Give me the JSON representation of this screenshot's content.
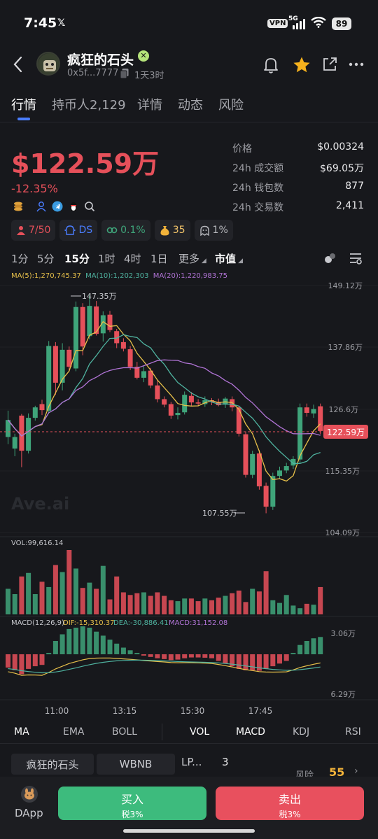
{
  "status_bar": {
    "time": "7:45",
    "x_label": "𝕏",
    "vpn": "VPN",
    "network": "5G",
    "battery": "89"
  },
  "token": {
    "name": "疯狂的石头",
    "address": "0x5f...7777",
    "age": "1天3时"
  },
  "tabs": [
    {
      "label": "行情",
      "active": true
    },
    {
      "label": "持币人2,129",
      "active": false
    },
    {
      "label": "详情",
      "active": false
    },
    {
      "label": "动态",
      "active": false
    },
    {
      "label": "风险",
      "active": false
    }
  ],
  "market": {
    "market_cap": "$122.59万",
    "change": "-12.35%"
  },
  "stats": [
    {
      "key": "价格",
      "value": "$0.00324"
    },
    {
      "key": "24h 成交额",
      "value": "$69.05万"
    },
    {
      "key": "24h 钱包数",
      "value": "877"
    },
    {
      "key": "24h 交易数",
      "value": "2,411"
    }
  ],
  "chips": [
    {
      "icon": "person-icon",
      "value": "7/50"
    },
    {
      "icon": "dev-icon",
      "value": "DS"
    },
    {
      "icon": "link-icon",
      "value": "0.1%"
    },
    {
      "icon": "money-bag-icon",
      "value": "35"
    },
    {
      "icon": "ghost-icon",
      "value": "1%"
    }
  ],
  "timeframes": [
    {
      "label": "1分",
      "active": false
    },
    {
      "label": "5分",
      "active": false
    },
    {
      "label": "15分",
      "active": true
    },
    {
      "label": "1时",
      "active": false
    },
    {
      "label": "4时",
      "active": false
    },
    {
      "label": "1日",
      "active": false
    },
    {
      "label": "更多",
      "active": false
    }
  ],
  "mode_select": "市值",
  "ma_legend": {
    "ma5": "MA(5):1,270,745.37",
    "ma10": "MA(10):1,202,303",
    "ma20": "MA(20):1,220,983.75"
  },
  "price_axis": [
    "149.12万",
    "137.86万",
    "126.6万",
    "115.35万",
    "104.09万"
  ],
  "current_tag": "122.59万",
  "high_label": "147.35万",
  "low_label": "107.55万",
  "watermark": "Ave.ai",
  "vol_label": "VOL:99,616.14",
  "macd_legend": {
    "title": "MACD(12,26,9)",
    "dif": "DIF:-15,310.37",
    "dea": "DEA:-30,886.41",
    "macd": "MACD:31,152.08"
  },
  "macd_axis": [
    "3.06万",
    "6.29万"
  ],
  "time_axis": [
    "11:00",
    "13:15",
    "15:30",
    "17:45"
  ],
  "indicators": [
    {
      "label": "MA",
      "active": true
    },
    {
      "label": "EMA",
      "active": false
    },
    {
      "label": "BOLL",
      "active": false
    },
    {
      "label": "VOL",
      "active": true
    },
    {
      "label": "MACD",
      "active": true
    },
    {
      "label": "KDJ",
      "active": false
    },
    {
      "label": "RSI",
      "active": false
    }
  ],
  "pair_tabs": [
    "疯狂的石头",
    "WBNB",
    "LP...",
    "3"
  ],
  "risk": {
    "label": "风险",
    "value": "55"
  },
  "bottom": {
    "dapp": "DApp",
    "buy": "买入",
    "buy_tax": "税3%",
    "sell": "卖出",
    "sell_tax": "税3%"
  },
  "colors": {
    "up": "#3fa47a",
    "down": "#e6505a",
    "accent": "#4a7dff",
    "ma5": "#e7c04a",
    "ma10": "#4fb3a0",
    "ma20": "#b174d6"
  },
  "candles": [
    [
      121.5,
      124.6,
      126.3,
      120.2
    ],
    [
      119.4,
      121.5,
      122.1,
      118.0
    ],
    [
      125.4,
      119.0,
      125.7,
      116.0
    ],
    [
      119.0,
      125.0,
      125.8,
      118.5
    ],
    [
      125.0,
      126.9,
      127.2,
      124.5
    ],
    [
      127.5,
      126.4,
      128.3,
      125.5
    ],
    [
      126.3,
      138.1,
      139.0,
      125.9
    ],
    [
      138.1,
      131.4,
      138.8,
      129.2
    ],
    [
      131.4,
      137.4,
      138.6,
      130.0
    ],
    [
      137.4,
      134.3,
      138.0,
      133.6
    ],
    [
      134.0,
      145.2,
      146.2,
      133.5
    ],
    [
      145.2,
      138.0,
      145.9,
      136.4
    ],
    [
      139.9,
      145.4,
      147.4,
      139.3
    ],
    [
      145.3,
      140.3,
      146.3,
      140.0
    ],
    [
      140.4,
      143.7,
      144.4,
      138.9
    ],
    [
      143.8,
      141.0,
      144.5,
      140.6
    ],
    [
      140.8,
      138.6,
      141.2,
      137.7
    ],
    [
      138.8,
      137.6,
      139.5,
      137.1
    ],
    [
      137.5,
      134.3,
      138.1,
      133.7
    ],
    [
      134.3,
      132.3,
      135.2,
      132.0
    ],
    [
      132.3,
      133.5,
      134.4,
      131.5
    ],
    [
      133.6,
      130.9,
      134.1,
      130.4
    ],
    [
      130.9,
      128.4,
      131.8,
      127.8
    ],
    [
      128.4,
      127.4,
      128.9,
      126.9
    ],
    [
      127.5,
      125.4,
      127.9,
      124.8
    ],
    [
      125.5,
      125.9,
      126.9,
      124.7
    ],
    [
      126.0,
      129.2,
      129.8,
      125.6
    ],
    [
      129.0,
      127.8,
      129.7,
      127.1
    ],
    [
      127.8,
      127.6,
      128.4,
      127.1
    ],
    [
      127.5,
      128.2,
      128.9,
      127.0
    ],
    [
      128.2,
      127.9,
      128.6,
      127.3
    ],
    [
      127.9,
      127.3,
      128.5,
      127.1
    ],
    [
      127.4,
      128.5,
      128.8,
      126.8
    ],
    [
      128.4,
      126.9,
      128.9,
      126.2
    ],
    [
      126.9,
      122.1,
      127.2,
      121.6
    ],
    [
      122.0,
      114.6,
      122.5,
      114.1
    ],
    [
      114.6,
      118.4,
      119.0,
      114.0
    ],
    [
      118.5,
      112.5,
      119.1,
      111.9
    ],
    [
      112.6,
      108.8,
      113.2,
      107.6
    ],
    [
      108.8,
      114.4,
      115.0,
      108.2
    ],
    [
      114.4,
      115.4,
      116.1,
      113.9
    ],
    [
      115.4,
      116.2,
      116.8,
      114.9
    ],
    [
      116.3,
      117.5,
      118.0,
      115.7
    ],
    [
      117.4,
      126.9,
      127.6,
      116.8
    ],
    [
      126.9,
      125.9,
      127.6,
      125.2
    ],
    [
      125.8,
      126.6,
      127.4,
      125.0
    ],
    [
      127.1,
      122.6,
      127.6,
      122.0
    ]
  ],
  "volume": [
    29,
    23,
    43,
    47,
    23,
    37,
    31,
    56,
    48,
    73,
    52,
    30,
    36,
    29,
    55,
    17,
    43,
    25,
    22,
    24,
    25,
    21,
    25,
    21,
    16,
    15,
    18,
    18,
    15,
    18,
    16,
    19,
    21,
    24,
    27,
    14,
    29,
    26,
    49,
    16,
    13,
    22,
    10,
    7,
    12,
    11,
    31
  ],
  "macd_hist": [
    -0.5,
    -0.6,
    -0.75,
    -0.55,
    -0.45,
    -0.4,
    0.05,
    0.5,
    0.75,
    0.95,
    1.0,
    1.05,
    1.0,
    0.85,
    0.7,
    0.55,
    0.4,
    0.25,
    0.15,
    0.05,
    -0.05,
    -0.1,
    -0.15,
    -0.18,
    -0.22,
    -0.2,
    -0.15,
    -0.12,
    -0.12,
    -0.13,
    -0.15,
    -0.25,
    -0.35,
    -0.45,
    -0.55,
    -0.6,
    -0.6,
    -0.62,
    -0.55,
    -0.45,
    -0.35,
    -0.25,
    0.05,
    0.35,
    0.5,
    0.6,
    0.65
  ]
}
